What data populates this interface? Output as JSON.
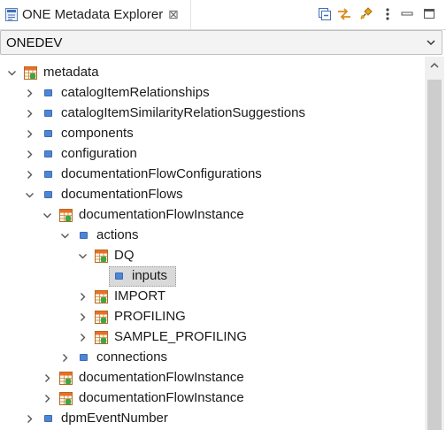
{
  "view": {
    "title": "ONE Metadata Explorer",
    "close_symbol": "⊠"
  },
  "toolbar": {
    "buttons": [
      "collapse-all-icon",
      "link-with-editor-icon",
      "pin-icon",
      "view-menu-icon",
      "minimize-icon",
      "maximize-icon"
    ]
  },
  "combo": {
    "value": "ONEDEV"
  },
  "tree": {
    "rows": [
      {
        "label": "metadata",
        "depth": 0,
        "state": "expanded",
        "icon": "table"
      },
      {
        "label": "catalogItemRelationships",
        "depth": 1,
        "state": "collapsed",
        "icon": "leaf"
      },
      {
        "label": "catalogItemSimilarityRelationSuggestions",
        "depth": 1,
        "state": "collapsed",
        "icon": "leaf"
      },
      {
        "label": "components",
        "depth": 1,
        "state": "collapsed",
        "icon": "leaf"
      },
      {
        "label": "configuration",
        "depth": 1,
        "state": "collapsed",
        "icon": "leaf"
      },
      {
        "label": "documentationFlowConfigurations",
        "depth": 1,
        "state": "collapsed",
        "icon": "leaf"
      },
      {
        "label": "documentationFlows",
        "depth": 1,
        "state": "expanded",
        "icon": "leaf"
      },
      {
        "label": "documentationFlowInstance",
        "depth": 2,
        "state": "expanded",
        "icon": "table"
      },
      {
        "label": "actions",
        "depth": 3,
        "state": "expanded",
        "icon": "leaf"
      },
      {
        "label": "DQ",
        "depth": 4,
        "state": "expanded",
        "icon": "table"
      },
      {
        "label": "inputs",
        "depth": 5,
        "state": "none",
        "icon": "leaf",
        "selected": true
      },
      {
        "label": "IMPORT",
        "depth": 4,
        "state": "collapsed",
        "icon": "table"
      },
      {
        "label": "PROFILING",
        "depth": 4,
        "state": "collapsed",
        "icon": "table"
      },
      {
        "label": "SAMPLE_PROFILING",
        "depth": 4,
        "state": "collapsed",
        "icon": "table"
      },
      {
        "label": "connections",
        "depth": 3,
        "state": "collapsed",
        "icon": "leaf"
      },
      {
        "label": "documentationFlowInstance",
        "depth": 2,
        "state": "collapsed",
        "icon": "table"
      },
      {
        "label": "documentationFlowInstance",
        "depth": 2,
        "state": "collapsed",
        "icon": "table"
      },
      {
        "label": "dpmEventNumber",
        "depth": 1,
        "state": "collapsed",
        "icon": "leaf"
      }
    ]
  },
  "colors": {
    "selection": "#d9d9d9",
    "leaf_icon": "#4f86d4",
    "table_header": "#e8702a",
    "table_body": "#3aa84a",
    "scroll_thumb": "#cdcdcd"
  }
}
